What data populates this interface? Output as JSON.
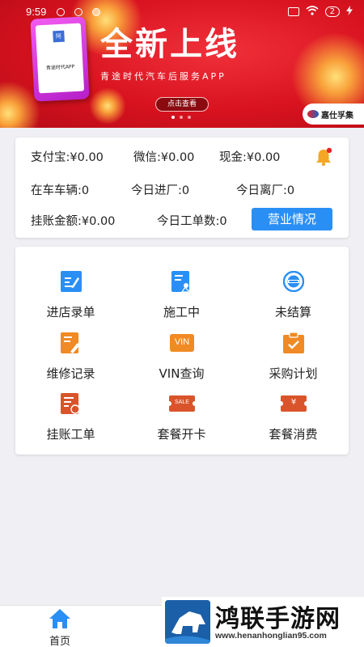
{
  "status_bar": {
    "time": "9:59",
    "battery": "2"
  },
  "banner": {
    "phone_label": "青途时代APP",
    "phone_logo": "阿",
    "title": "全新上线",
    "subtitle": "青途时代汽车后服务APP",
    "button": "点击查看",
    "brand": "嘉仕孚集"
  },
  "stats": {
    "alipay": "支付宝:¥0.00",
    "wechat": "微信:¥0.00",
    "cash": "现金:¥0.00",
    "vehicles_in_shop": "在车车辆:0",
    "today_in": "今日进厂:0",
    "today_out": "今日离厂:0",
    "credit_amount": "挂账金额:¥0.00",
    "today_orders": "今日工单数:0",
    "business_button": "营业情况"
  },
  "grid": {
    "items": [
      {
        "label": "进店录单",
        "icon": "edit-document-icon"
      },
      {
        "label": "施工中",
        "icon": "construction-document-icon"
      },
      {
        "label": "未结算",
        "icon": "settlement-icon"
      },
      {
        "label": "维修记录",
        "icon": "repair-record-icon"
      },
      {
        "label": "VIN查询",
        "icon": "vin-icon"
      },
      {
        "label": "采购计划",
        "icon": "clipboard-check-icon"
      },
      {
        "label": "挂账工单",
        "icon": "credit-order-icon"
      },
      {
        "label": "套餐开卡",
        "icon": "sale-card-icon"
      },
      {
        "label": "套餐消费",
        "icon": "yen-card-icon"
      }
    ],
    "vin_text": "VIN",
    "sale_text": "SALE",
    "yen_text": "¥"
  },
  "bottom_nav": {
    "home": "首页"
  },
  "watermark": {
    "title": "鸿联手游网",
    "url": "www.henanhonglian95.com"
  },
  "colors": {
    "primary": "#2a8ff5",
    "banner_red": "#d8121f",
    "icon_orange": "#f08a24",
    "icon_blue": "#2a8ff5"
  }
}
